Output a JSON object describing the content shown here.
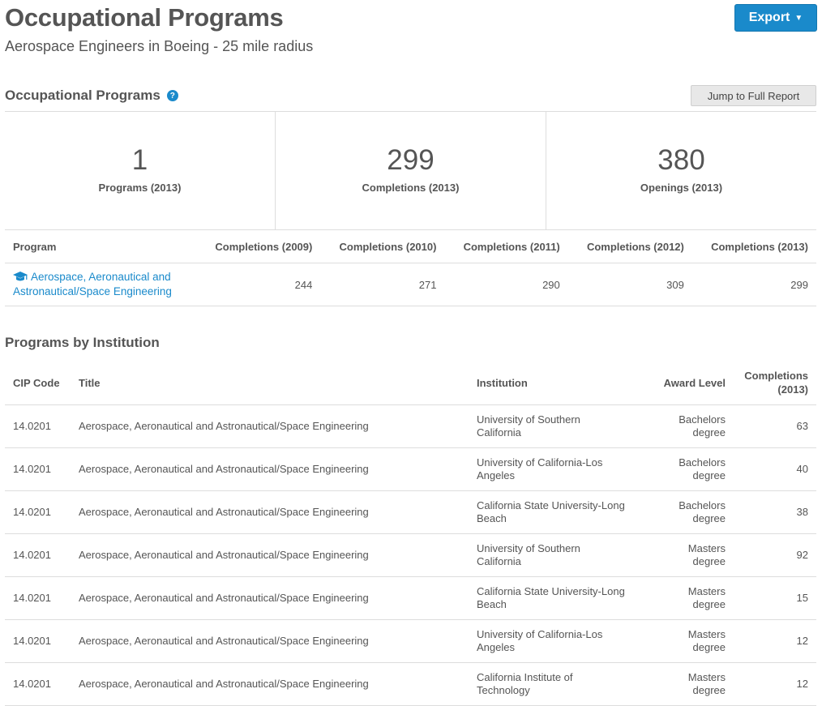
{
  "header": {
    "title": "Occupational Programs",
    "subtitle": "Aerospace Engineers in Boeing - 25 mile radius",
    "export_label": "Export"
  },
  "section": {
    "title": "Occupational Programs",
    "help_icon": "?",
    "jump_label": "Jump to Full Report"
  },
  "stats": [
    {
      "value": "1",
      "label": "Programs (2013)"
    },
    {
      "value": "299",
      "label": "Completions (2013)"
    },
    {
      "value": "380",
      "label": "Openings (2013)"
    }
  ],
  "program_table": {
    "headers": [
      "Program",
      "Completions (2009)",
      "Completions (2010)",
      "Completions (2011)",
      "Completions (2012)",
      "Completions (2013)"
    ],
    "rows": [
      {
        "program_line1": "Aerospace, Aeronautical and",
        "program_line2": "Astronautical/Space Engineering",
        "values": [
          "244",
          "271",
          "290",
          "309",
          "299"
        ]
      }
    ]
  },
  "institutions": {
    "title": "Programs by Institution",
    "headers": {
      "cip": "CIP Code",
      "title": "Title",
      "institution": "Institution",
      "award": "Award Level",
      "completions_line1": "Completions",
      "completions_line2": "(2013)"
    },
    "rows": [
      {
        "cip": "14.0201",
        "title": "Aerospace, Aeronautical and Astronautical/Space Engineering",
        "inst1": "University of Southern",
        "inst2": "California",
        "award1": "Bachelors",
        "award2": "degree",
        "completions": "63"
      },
      {
        "cip": "14.0201",
        "title": "Aerospace, Aeronautical and Astronautical/Space Engineering",
        "inst1": "University of California-Los",
        "inst2": "Angeles",
        "award1": "Bachelors",
        "award2": "degree",
        "completions": "40"
      },
      {
        "cip": "14.0201",
        "title": "Aerospace, Aeronautical and Astronautical/Space Engineering",
        "inst1": "California State University-Long",
        "inst2": "Beach",
        "award1": "Bachelors",
        "award2": "degree",
        "completions": "38"
      },
      {
        "cip": "14.0201",
        "title": "Aerospace, Aeronautical and Astronautical/Space Engineering",
        "inst1": "University of Southern",
        "inst2": "California",
        "award1": "Masters",
        "award2": "degree",
        "completions": "92"
      },
      {
        "cip": "14.0201",
        "title": "Aerospace, Aeronautical and Astronautical/Space Engineering",
        "inst1": "California State University-Long",
        "inst2": "Beach",
        "award1": "Masters",
        "award2": "degree",
        "completions": "15"
      },
      {
        "cip": "14.0201",
        "title": "Aerospace, Aeronautical and Astronautical/Space Engineering",
        "inst1": "University of California-Los",
        "inst2": "Angeles",
        "award1": "Masters",
        "award2": "degree",
        "completions": "12"
      },
      {
        "cip": "14.0201",
        "title": "Aerospace, Aeronautical and Astronautical/Space Engineering",
        "inst1": "California Institute of",
        "inst2": "Technology",
        "award1": "Masters",
        "award2": "degree",
        "completions": "12"
      }
    ]
  },
  "colors": {
    "accent": "#1a8acb",
    "text": "#555555",
    "border": "#dddddd"
  }
}
